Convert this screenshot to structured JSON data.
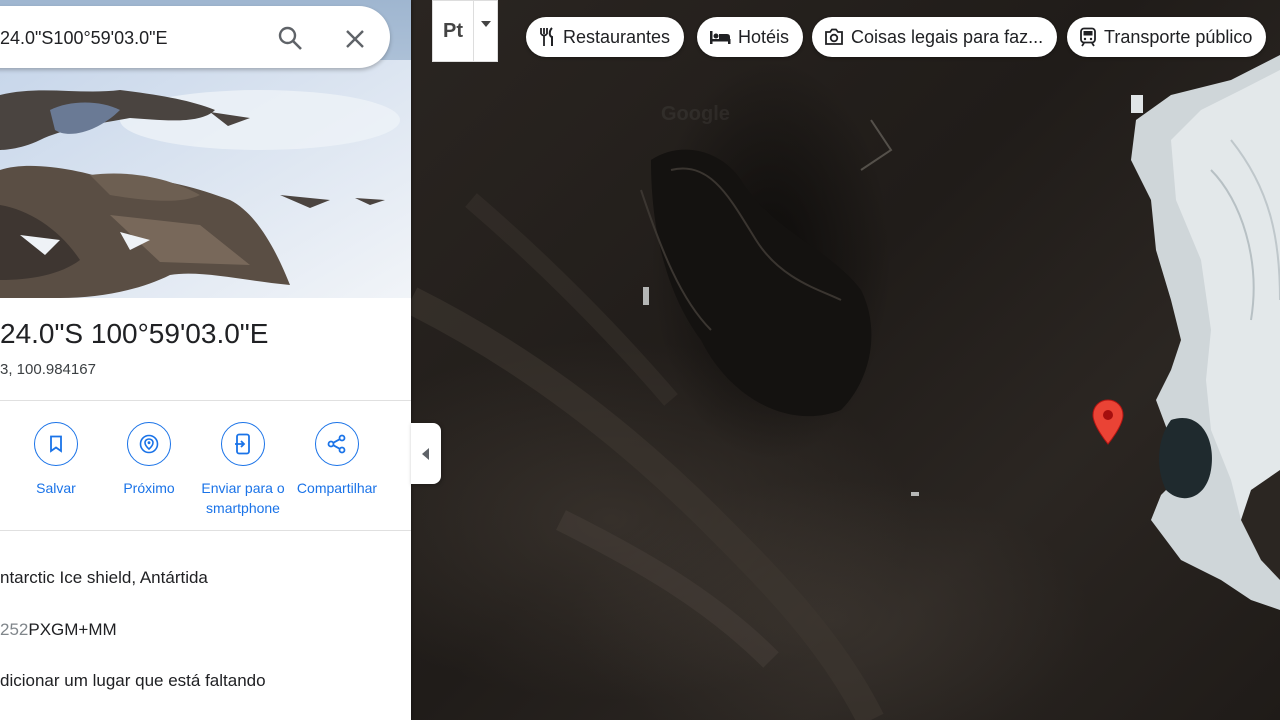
{
  "search": {
    "query": "24.0\"S100°59'03.0\"E"
  },
  "place": {
    "title": "24.0\"S 100°59'03.0\"E",
    "coords": "3, 100.984167"
  },
  "actions": [
    {
      "label": "Salvar",
      "icon": "bookmark-icon"
    },
    {
      "label": "Próximo",
      "icon": "nearby-icon"
    },
    {
      "label": "Enviar para o smartphone",
      "icon": "send-to-phone-icon"
    },
    {
      "label": "Compartilhar",
      "icon": "share-icon"
    }
  ],
  "info": {
    "location": "ntarctic Ice shield, Antártida",
    "pluscode_prefix": "252",
    "pluscode": "PXGM+MM",
    "add_missing": "dicionar um lugar que está faltando"
  },
  "layer_toggle": {
    "label": "Pt"
  },
  "chips": [
    {
      "label": "Restaurantes",
      "icon": "fork-knife-icon"
    },
    {
      "label": "Hotéis",
      "icon": "bed-icon"
    },
    {
      "label": "Coisas legais para faz...",
      "icon": "camera-icon"
    },
    {
      "label": "Transporte público",
      "icon": "train-icon"
    }
  ],
  "map": {
    "watermark": "Google",
    "pin_color": "#ea4335"
  },
  "colors": {
    "accent": "#1a73e8"
  }
}
